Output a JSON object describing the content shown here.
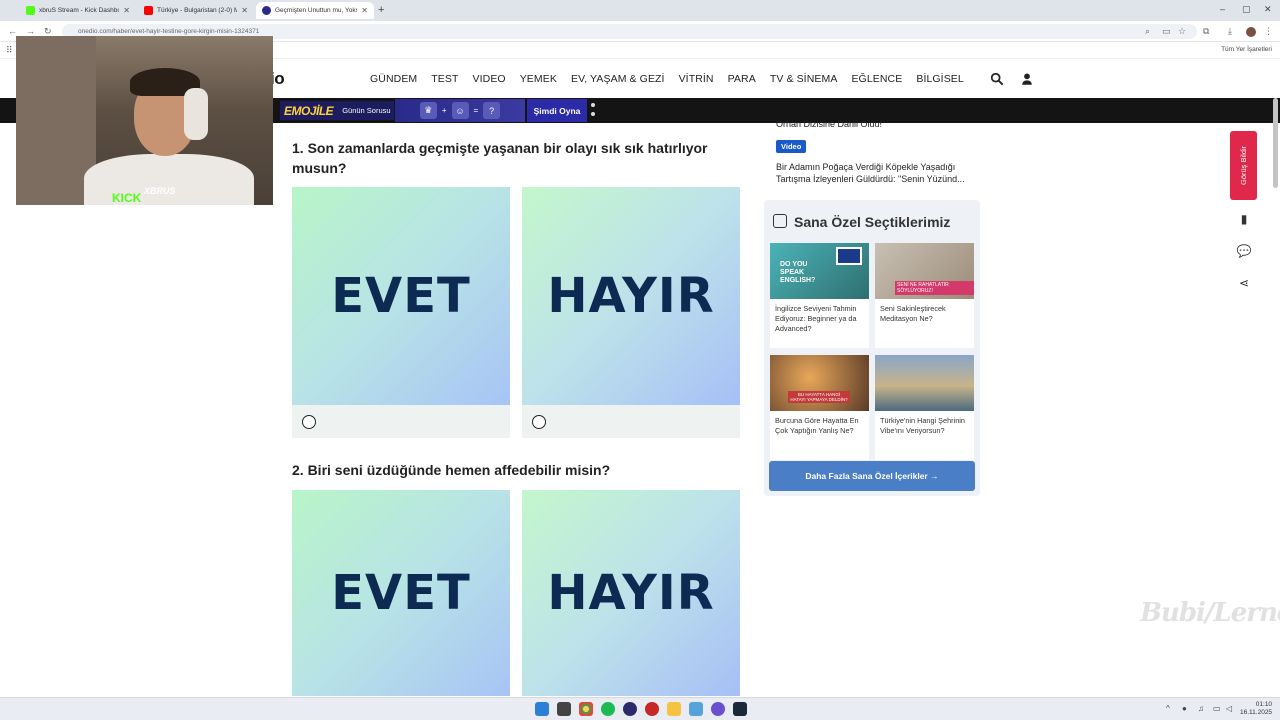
{
  "browser": {
    "tabs": [
      {
        "label": "xbruS Stream - Kick Dashboard",
        "color": "#53fc18"
      },
      {
        "label": "Türkiye - Bulgaristan (2-0) Maç",
        "color": "#ff0000"
      },
      {
        "label": "Geçmişten Unuttun mu, Yoksa...",
        "color": "#2a2a8a"
      }
    ],
    "url": "onedio.com/haber/evet-hayir-testine-gore-kirgin-misin-1324371",
    "bookmarks_all": "Tüm Yer İşaretleri"
  },
  "site": {
    "logo": "io",
    "nav": [
      "GÜNDEM",
      "TEST",
      "VIDEO",
      "YEMEK",
      "EV, YAŞAM & GEZİ",
      "VİTRİN",
      "PARA",
      "TV & SİNEMA",
      "EĞLENCE",
      "BİLGİSEL"
    ],
    "promo": {
      "brand": "EMOJİLE",
      "label": "Günün Sorusu",
      "play": "Şimdi Oyna",
      "plus": "+",
      "equals": "=",
      "unknown": "?"
    }
  },
  "quiz": {
    "questions": [
      {
        "text": "1. Son zamanlarda geçmişte yaşanan bir olayı sık sık hatırlıyor musun?",
        "yes": "EVET",
        "no": "HAYIR"
      },
      {
        "text": "2. Biri seni üzdüğünde hemen affedebilir misin?",
        "yes": "EVET",
        "no": "HAYIR"
      }
    ]
  },
  "sidebar": {
    "related_top": "Orhan Dizisine Dahil Oldu!",
    "video_badge": "Video",
    "related_video": "Bir Adamın Poğaça Verdiği Köpekle Yaşadığı Tartışma İzleyenleri Güldürdü: \"Senin Yüzünd...",
    "picks_title": "Sana Özel Seçtiklerimiz",
    "picks": [
      {
        "caption": "İngilizce Seviyeni Tahmin Ediyoruz: Beginner ya da Advanced?",
        "img_text": "DO YOU SPEAK ENGLISH?"
      },
      {
        "caption": "Seni Sakinleştirecek Meditasyon Ne?",
        "img_text": "SENİ NE RAHATLATIR SÖYLÜYORUZ!"
      },
      {
        "caption": "Burcuna Göre Hayatta En Çok Yaptığın Yanlış Ne?",
        "img_text": "BU HAYATTA HANGİ HATAYI YAPMAYA DELDİN?"
      },
      {
        "caption": "Türkiye'nin Hangi Şehrinin Vibe'ını Veriyorsun?",
        "img_text": ""
      }
    ],
    "more_button": "Daha Fazla Sana Özel İçerikler →",
    "feedback": "Görüş Bildir"
  },
  "overlay": {
    "kick": "KICK",
    "brand": "XBRUS"
  },
  "watermark": "Bubi/Lerne",
  "taskbar": {
    "time": "01:10",
    "date": "16.11.2025"
  },
  "colors": {
    "accent": "#1a59c9",
    "feedback": "#e0284a",
    "answer_text": "#0d2a52"
  }
}
